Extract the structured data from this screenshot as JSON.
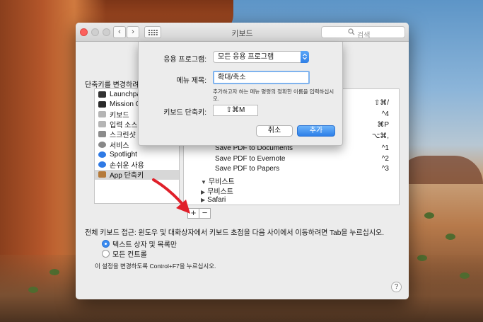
{
  "window": {
    "title": "키보드",
    "search_placeholder": "검색",
    "nav_back": "‹",
    "nav_forward": "›"
  },
  "left_panel": {
    "label": "단축키를 변경하려",
    "categories": [
      {
        "label": "Launchpa",
        "icon": "launchpad-icon",
        "color": "#333333"
      },
      {
        "label": "Mission C",
        "icon": "mission-control-icon",
        "color": "#2b2b2b"
      },
      {
        "label": "키보드",
        "icon": "keyboard-icon",
        "color": "#b5b5b5"
      },
      {
        "label": "입력 소스",
        "icon": "input-source-icon",
        "color": "#b5b5b5"
      },
      {
        "label": "스크린샷",
        "icon": "screenshot-icon",
        "color": "#8c8c8c"
      },
      {
        "label": "서비스",
        "icon": "services-gear-icon",
        "color": "#888888"
      },
      {
        "label": "Spotlight",
        "icon": "spotlight-icon",
        "color": "#2f7ae5"
      },
      {
        "label": "손쉬운 사용",
        "icon": "accessibility-icon",
        "color": "#2f7ae5"
      },
      {
        "label": "App 단축키",
        "icon": "app-shortcuts-icon",
        "color": "#b57a3a",
        "selected": true
      }
    ]
  },
  "shortcuts": {
    "top_keys": [
      "⇧⌘/",
      "^4",
      "⌘P",
      "⌥⌘,"
    ],
    "rows": [
      {
        "label": "Save PDF to Documents",
        "key": "^1",
        "indent": 1
      },
      {
        "label": "Save PDF to Evernote",
        "key": "^2",
        "indent": 1
      },
      {
        "label": "Save PDF to Papers",
        "key": "^3",
        "indent": 1
      },
      {
        "label": "무비스트",
        "key": "",
        "indent": 0,
        "triangle": "▼"
      },
      {
        "label": "무비스트",
        "key": "",
        "indent": 0,
        "triangle": "▶"
      },
      {
        "label": "Safari",
        "key": "",
        "indent": 0,
        "triangle": "▶"
      }
    ],
    "add_label": "+",
    "remove_label": "−"
  },
  "full_access": {
    "text": "전체 키보드 접근: 윈도우 및 대화상자에서 키보드 초점을 다음 사이에서 이동하려면 Tab을 누르십시오.",
    "options": [
      {
        "label": "텍스트 상자 및 목록만",
        "selected": true
      },
      {
        "label": "모든 컨트롤",
        "selected": false
      }
    ],
    "hint": "이 설정을 변경하도록 Control+F7을 누르십시오.",
    "help": "?"
  },
  "sheet": {
    "app_label": "응용 프로그램:",
    "app_value": "모든 응용 프로그램",
    "menu_label": "메뉴 제목:",
    "menu_value": "확대/축소",
    "description": "추가하고자 하는 메뉴 명령의 정확한 이름을 입력하십시오.",
    "shortcut_label": "키보드 단축키:",
    "shortcut_value": "⇧⌘M",
    "cancel": "취소",
    "add": "추가"
  },
  "colors": {
    "accent": "#2f7fe6",
    "annotation_arrow": "#e0202a"
  }
}
